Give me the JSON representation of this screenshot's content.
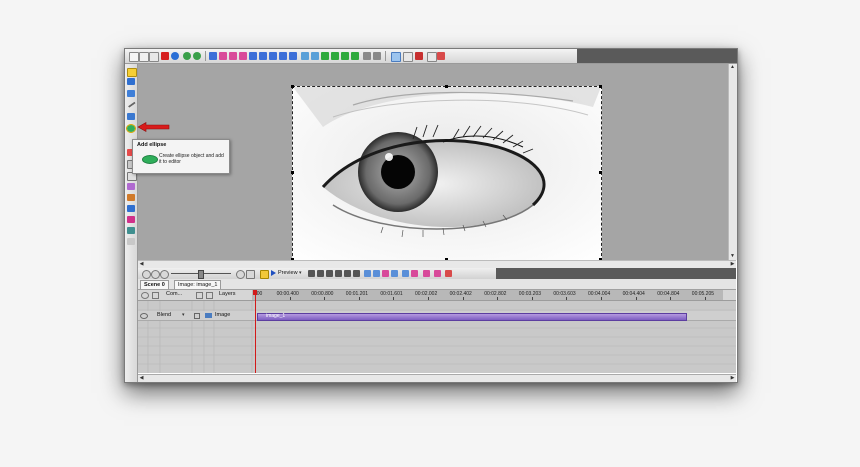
{
  "tabs": {
    "scene": "Scene 0",
    "object": "Image: image_1"
  },
  "timeline_header": {
    "col1": "Com...",
    "col2": "Layers"
  },
  "layer_row": {
    "blend": "Blend",
    "layer_name": "Image",
    "clip_label": "image_1"
  },
  "timeline_toolbar": {
    "preview": "Preview"
  },
  "ruler": {
    "labels": [
      "000",
      "00:00.400",
      "00:00.800",
      "00:01.201",
      "00:01.601",
      "00:02.002",
      "00:02.402",
      "00:02.802",
      "00:03.203",
      "00:03.603",
      "00:04.004",
      "00:04.404",
      "00:04.804",
      "00:05.205"
    ]
  },
  "tooltip": {
    "title": "Add ellipse",
    "body": "Create ellipse object and add it to editor"
  },
  "colors": {
    "canvas_bg": "#a5a5a5",
    "clip": "#7d5ec2",
    "playhead": "#d21a1a",
    "arrow": "#d81c1c",
    "ellipse_icon": "#2fae5a"
  },
  "icons": [
    "new-icon",
    "open-icon",
    "save-icon",
    "delete-icon",
    "undo-icon",
    "redo-icon",
    "align-icon",
    "arrow-up-icon",
    "arrow-down-icon",
    "select-icon",
    "text-icon",
    "ellipse-icon",
    "rectangle-icon",
    "line-icon",
    "audio-icon"
  ]
}
